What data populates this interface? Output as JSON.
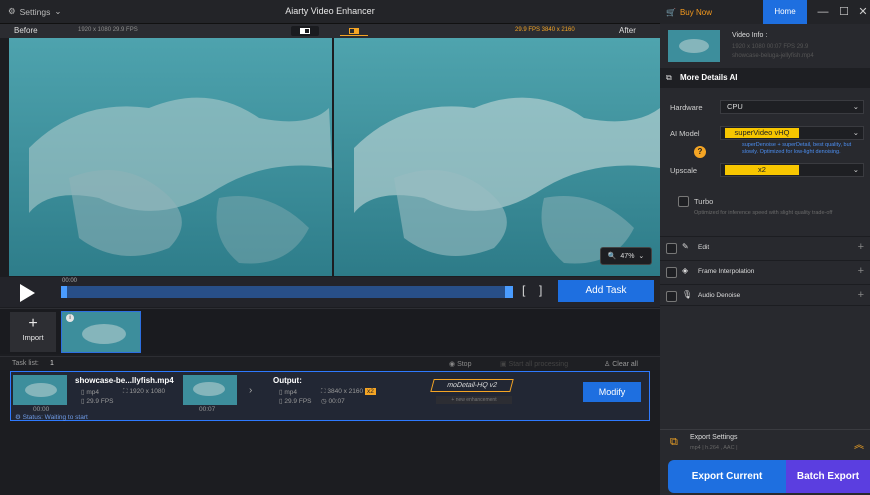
{
  "app": {
    "title": "Aiarty Video Enhancer",
    "settings_label": "Settings"
  },
  "top_right": {
    "buy_label": "Buy Now",
    "home_label": "Home"
  },
  "compare": {
    "before_label": "Before",
    "before_info": "1920 x 1080  29.9 FPS",
    "after_info": "29.9 FPS  3840 x 2160",
    "after_label": "After"
  },
  "zoom": {
    "value": "47%"
  },
  "timeline": {
    "time": "00:00",
    "add_task_label": "Add Task"
  },
  "import": {
    "label": "Import"
  },
  "tasks": {
    "header": "Task list:",
    "count": "1",
    "stop_label": "Stop",
    "start_label": "Start all processing",
    "clear_label": "Clear all",
    "item": {
      "name": "showcase-be...llyfish.mp4",
      "format": "mp4",
      "resolution": "1920 x 1080",
      "fps": "29.9 FPS",
      "thumb_start": "00:00",
      "thumb_end": "00:07",
      "output_label": "Output:",
      "out_format": "mp4",
      "out_resolution": "3840 x 2160",
      "out_scale": "x2",
      "out_fps": "29.9 FPS",
      "out_duration": "00:07",
      "model": "moDetail-HQ  v2",
      "model_sub": "+ new enhancement",
      "modify_label": "Modify",
      "status": "Status: Waiting to start"
    }
  },
  "panel": {
    "video_info_label": "Video Info :",
    "video_info_line1": "1920 x 1080  00:07  FPS 29.9",
    "video_info_line2": "showcase-beluga-jellyfish.mp4",
    "more_details": "More Details AI",
    "hardware_label": "Hardware",
    "hardware_value": "CPU",
    "model_label": "AI Model",
    "model_value": "superVideo vHQ",
    "model_desc": "superDenoise + superDetail, best quality, but slowly. Optimized for low-light denoising.",
    "upscale_label": "Upscale",
    "upscale_value": "x2",
    "turbo_label": "Turbo",
    "turbo_desc": "Optimized for inference speed with slight quality trade-off",
    "edit_label": "Edit",
    "frame_label": "Frame Interpolation",
    "audio_label": "Audio Denoise",
    "export_settings": "Export Settings",
    "export_sub": "mp4 | h.264 , AAC |",
    "export_current": "Export Current",
    "batch_export": "Batch Export"
  },
  "colors": {
    "accent_blue": "#1e6fe0",
    "accent_orange": "#f5a524",
    "accent_yellow": "#f7c600",
    "batch_purple": "#5b3ee0"
  }
}
